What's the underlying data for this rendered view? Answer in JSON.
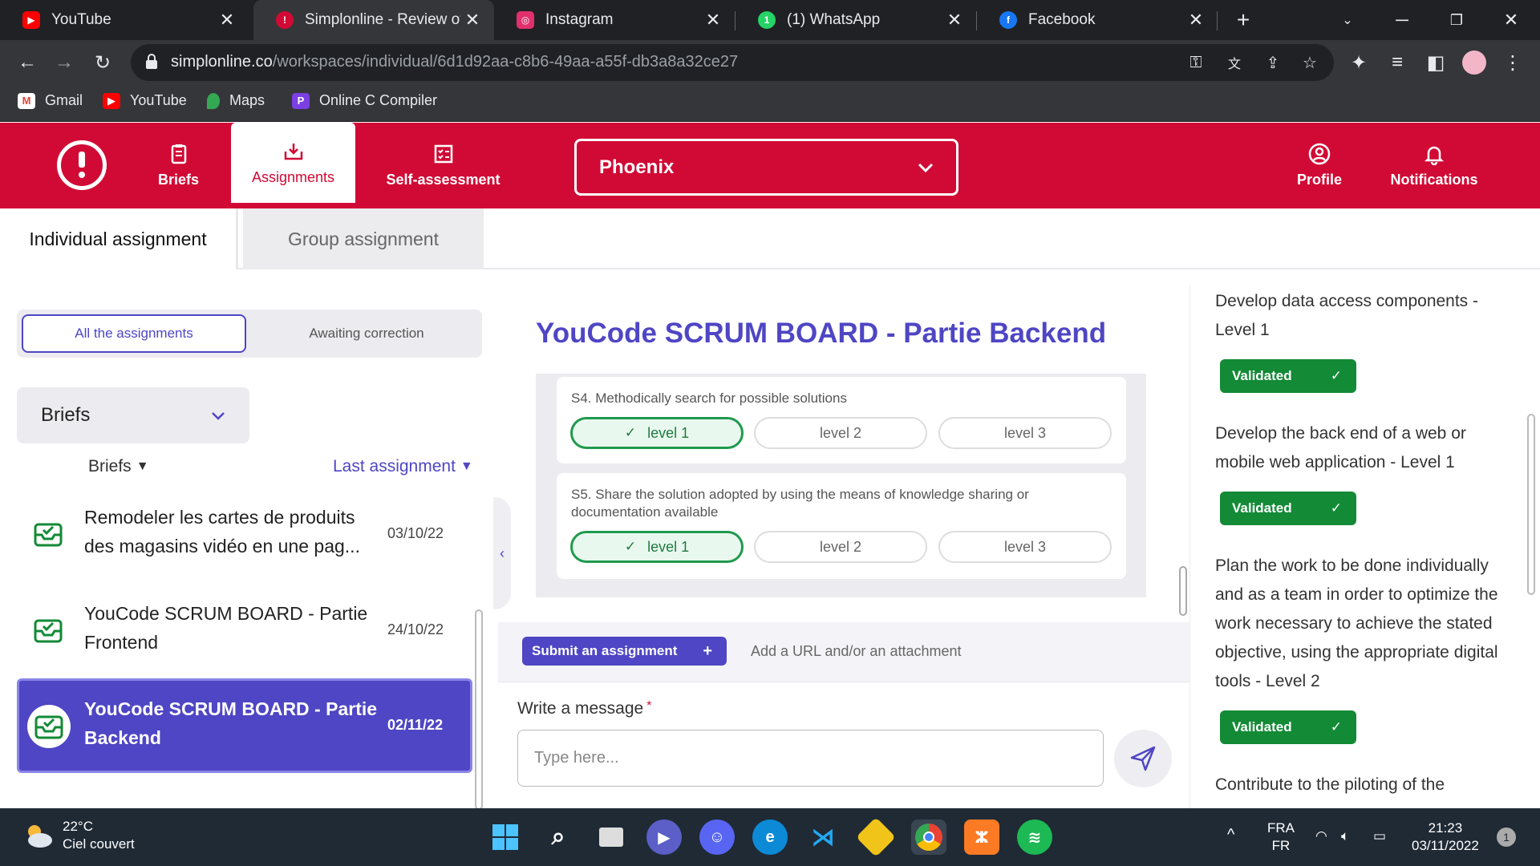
{
  "browser": {
    "tabs": [
      {
        "title": "YouTube",
        "icon": "youtube-icon",
        "color": "#ff0000"
      },
      {
        "title": "Simplonline - Review of Yo",
        "icon": "simplonline-icon",
        "color": "#d10a35"
      },
      {
        "title": "Instagram",
        "icon": "instagram-icon",
        "color": "#e1306c"
      },
      {
        "title": "(1) WhatsApp",
        "icon": "whatsapp-icon",
        "color": "#25d366"
      },
      {
        "title": "Facebook",
        "icon": "facebook-icon",
        "color": "#1877f2"
      }
    ],
    "url_domain": "simplonline.co",
    "url_path": "/workspaces/individual/6d1d92aa-c8b6-49aa-a55f-db3a8a32ce27",
    "bookmarks": [
      {
        "label": "Gmail",
        "icon": "gmail-icon"
      },
      {
        "label": "YouTube",
        "icon": "youtube-icon"
      },
      {
        "label": "Maps",
        "icon": "maps-icon"
      },
      {
        "label": "Online C Compiler",
        "icon": "compiler-icon"
      }
    ]
  },
  "app": {
    "brand_color": "#d10a35",
    "accent_color": "#4e46c4",
    "nav": {
      "briefs": "Briefs",
      "assignments": "Assignments",
      "self_assessment": "Self-assessment",
      "profile": "Profile",
      "notifications": "Notifications"
    },
    "promotion": "Phoenix",
    "subtabs": {
      "individual": "Individual assignment",
      "group": "Group assignment"
    }
  },
  "left": {
    "filter": {
      "all": "All the assignments",
      "awaiting": "Awaiting correction"
    },
    "dropdown": "Briefs",
    "sort": {
      "left": "Briefs",
      "right": "Last assignment"
    },
    "items": [
      {
        "title": "Remodeler les cartes de produits des magasins vidéo en une pag...",
        "date": "03/10/22"
      },
      {
        "title": "YouCode SCRUM BOARD - Partie Frontend",
        "date": "24/10/22"
      },
      {
        "title": "YouCode SCRUM BOARD - Partie Backend",
        "date": "02/11/22"
      }
    ]
  },
  "center": {
    "title": "YouCode SCRUM BOARD - Partie Backend",
    "criteria": [
      {
        "label": "S4. Methodically search for possible solutions",
        "levels": [
          "level 1",
          "level 2",
          "level 3"
        ],
        "selected": 0
      },
      {
        "label": "S5. Share the solution adopted by using the means of knowledge sharing or documentation available",
        "levels": [
          "level 1",
          "level 2",
          "level 3"
        ],
        "selected": 0
      }
    ],
    "submit_label": "Submit an assignment",
    "add_url": "Add a URL and/or an attachment",
    "message_label": "Write a message",
    "message_required": "*",
    "message_placeholder": "Type here..."
  },
  "right": {
    "skills": [
      {
        "text": "Develop data access components - Level 1",
        "status": "Validated"
      },
      {
        "text": "Develop the back end of a web or mobile web application - Level 1",
        "status": "Validated"
      },
      {
        "text": "Plan the work to be done individually and as a team in order to optimize the work necessary to achieve the stated objective, using the appropriate digital tools - Level 2",
        "status": "Validated"
      },
      {
        "text": "Contribute to the piloting of the",
        "status": ""
      }
    ],
    "validated_color": "#138a36"
  },
  "taskbar": {
    "temperature": "22°C",
    "weather": "Ciel couvert",
    "lang1": "FRA",
    "lang2": "FR",
    "time": "21:23",
    "date": "03/11/2022",
    "notif_count": "1"
  }
}
